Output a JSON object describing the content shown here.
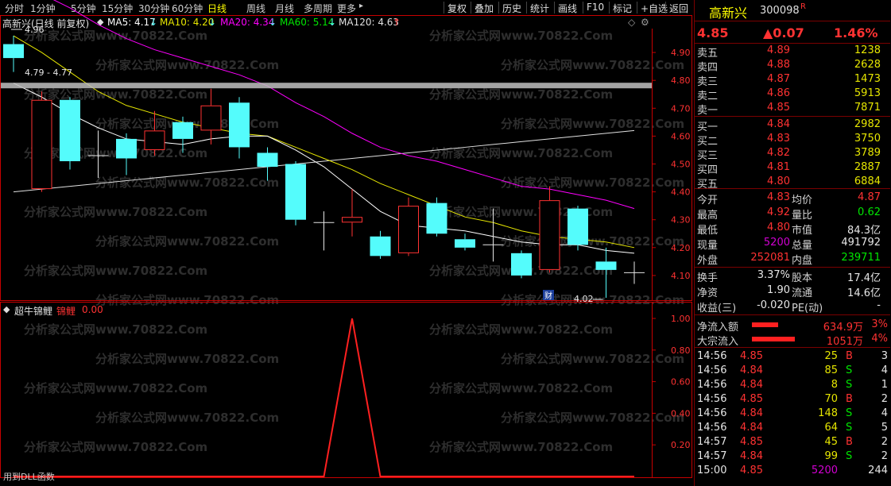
{
  "toolbar": {
    "periods": [
      "分时",
      "1分钟",
      "5分钟",
      "15分钟",
      "30分钟",
      "60分钟",
      "日线",
      "周线",
      "月线",
      "多周期",
      "更多"
    ],
    "active_period": "日线",
    "more_arrow": "▸",
    "buttons": [
      "复权",
      "叠加",
      "历史",
      "统计",
      "画线",
      "F10",
      "标记",
      "+自选",
      "返回"
    ]
  },
  "chart": {
    "stock_label": "高新兴(日线 前复权)",
    "ma5": "MA5: 4.17",
    "ma5_arrow": "↓",
    "ma10": "MA10: 4.20",
    "ma10_arrow": "↓",
    "ma20": "MA20: 4.34",
    "ma20_arrow": "↓",
    "ma60": "MA60: 5.14",
    "ma60_arrow": "↓",
    "ma120": "MA120: 4.63",
    "ma120_arrow": "↑",
    "high_annot": "4.96",
    "line_annot": "4.79 - 4.77",
    "low_annot": "4.02",
    "fin_badge": "财",
    "watermark": "分析家公式网www.70822.Com",
    "colors": {
      "up": "#ff3232",
      "down": "#54fcfc",
      "ma5": "#ffffff",
      "ma10": "#e6e600",
      "ma20": "#ff00ff",
      "ma60": "#00e600",
      "ma120": "#ffffff",
      "axis": "#c80000"
    }
  },
  "chart_data": [
    {
      "type": "candlestick",
      "y_ticks": [
        4.1,
        4.2,
        4.3,
        4.4,
        4.5,
        4.6,
        4.7,
        4.8,
        4.9
      ],
      "ylim": [
        4.02,
        4.98
      ],
      "candles": [
        {
          "o": 4.93,
          "h": 4.96,
          "l": 4.83,
          "c": 4.88
        },
        {
          "o": 4.41,
          "h": 4.76,
          "l": 4.4,
          "c": 4.73
        },
        {
          "o": 4.73,
          "h": 4.74,
          "l": 4.48,
          "c": 4.51
        },
        {
          "o": 4.53,
          "h": 4.62,
          "l": 4.45,
          "c": 4.53
        },
        {
          "o": 4.59,
          "h": 4.61,
          "l": 4.46,
          "c": 4.52
        },
        {
          "o": 4.55,
          "h": 4.69,
          "l": 4.53,
          "c": 4.62
        },
        {
          "o": 4.65,
          "h": 4.67,
          "l": 4.54,
          "c": 4.59
        },
        {
          "o": 4.62,
          "h": 4.77,
          "l": 4.57,
          "c": 4.71
        },
        {
          "o": 4.72,
          "h": 4.74,
          "l": 4.52,
          "c": 4.56
        },
        {
          "o": 4.54,
          "h": 4.56,
          "l": 4.44,
          "c": 4.49
        },
        {
          "o": 4.5,
          "h": 4.51,
          "l": 4.28,
          "c": 4.3
        },
        {
          "o": 4.29,
          "h": 4.33,
          "l": 4.19,
          "c": 4.29
        },
        {
          "o": 4.29,
          "h": 4.41,
          "l": 4.24,
          "c": 4.31
        },
        {
          "o": 4.24,
          "h": 4.26,
          "l": 4.16,
          "c": 4.17
        },
        {
          "o": 4.18,
          "h": 4.38,
          "l": 4.17,
          "c": 4.35
        },
        {
          "o": 4.36,
          "h": 4.38,
          "l": 4.24,
          "c": 4.25
        },
        {
          "o": 4.23,
          "h": 4.25,
          "l": 4.19,
          "c": 4.2
        },
        {
          "o": 4.21,
          "h": 4.34,
          "l": 4.15,
          "c": 4.21
        },
        {
          "o": 4.18,
          "h": 4.19,
          "l": 4.09,
          "c": 4.1
        },
        {
          "o": 4.12,
          "h": 4.42,
          "l": 4.11,
          "c": 4.37
        },
        {
          "o": 4.34,
          "h": 4.35,
          "l": 4.19,
          "c": 4.21
        },
        {
          "o": 4.15,
          "h": 4.2,
          "l": 4.02,
          "c": 4.12
        },
        {
          "o": 4.1,
          "h": 4.15,
          "l": 4.07,
          "c": 4.11
        }
      ],
      "ma5": [
        4.79,
        4.74,
        4.68,
        4.63,
        4.59,
        4.58,
        4.57,
        4.59,
        4.6,
        4.6,
        4.55,
        4.49,
        4.41,
        4.33,
        4.28,
        4.27,
        4.26,
        4.24,
        4.22,
        4.21,
        4.21,
        4.19,
        4.18
      ],
      "ma10": [
        4.96,
        4.9,
        4.83,
        4.76,
        4.71,
        4.68,
        4.65,
        4.63,
        4.61,
        4.6,
        4.56,
        4.52,
        4.48,
        4.43,
        4.39,
        4.35,
        4.31,
        4.29,
        4.26,
        4.24,
        4.23,
        4.22,
        4.2
      ],
      "ma20": [
        5.14,
        5.11,
        5.06,
        5.0,
        4.95,
        4.91,
        4.88,
        4.85,
        4.82,
        4.78,
        4.72,
        4.67,
        4.61,
        4.56,
        4.53,
        4.51,
        4.48,
        4.45,
        4.42,
        4.41,
        4.39,
        4.37,
        4.34
      ],
      "ma120": [
        4.4,
        4.41,
        4.42,
        4.43,
        4.44,
        4.45,
        4.46,
        4.47,
        4.48,
        4.49,
        4.5,
        4.51,
        4.52,
        4.53,
        4.54,
        4.55,
        4.56,
        4.57,
        4.58,
        4.59,
        4.6,
        4.61,
        4.62
      ],
      "ma_line": 4.78
    },
    {
      "type": "line",
      "title": "超牛锦鲤",
      "series_label": "锦鲤",
      "current_value": "0.00",
      "y_ticks": [
        0.0,
        0.2,
        0.4,
        0.6,
        0.8,
        1.0
      ],
      "ylim": [
        0,
        1.0
      ],
      "values": [
        0,
        0,
        0,
        0,
        0,
        0,
        0,
        0,
        0,
        0,
        0,
        0,
        1,
        0,
        0,
        0,
        0,
        0,
        0,
        0,
        0,
        0,
        0
      ]
    }
  ],
  "indicator_footer": "用到DLL函数",
  "panel": {
    "name": "高新兴",
    "code": "300098",
    "tag": "R",
    "price": "4.85",
    "change": "▲0.07",
    "change_pct": "1.46%",
    "asks": [
      {
        "label": "卖五",
        "price": "4.89",
        "vol": "1238"
      },
      {
        "label": "卖四",
        "price": "4.88",
        "vol": "2628"
      },
      {
        "label": "卖三",
        "price": "4.87",
        "vol": "1473"
      },
      {
        "label": "卖二",
        "price": "4.86",
        "vol": "5913"
      },
      {
        "label": "卖一",
        "price": "4.85",
        "vol": "7871"
      }
    ],
    "bids": [
      {
        "label": "买一",
        "price": "4.84",
        "vol": "2982"
      },
      {
        "label": "买二",
        "price": "4.83",
        "vol": "3750"
      },
      {
        "label": "买三",
        "price": "4.82",
        "vol": "3789"
      },
      {
        "label": "买四",
        "price": "4.81",
        "vol": "2887"
      },
      {
        "label": "买五",
        "price": "4.80",
        "vol": "6884"
      }
    ],
    "stats": [
      {
        "l1": "今开",
        "v1": "4.83",
        "c1": "red",
        "l2": "均价",
        "v2": "4.87",
        "c2": "red"
      },
      {
        "l1": "最高",
        "v1": "4.92",
        "c1": "red",
        "l2": "量比",
        "v2": "0.62",
        "c2": "green"
      },
      {
        "l1": "最低",
        "v1": "4.80",
        "c1": "red",
        "l2": "市值",
        "v2": "84.3亿",
        "c2": "white"
      },
      {
        "l1": "现量",
        "v1": "5200",
        "c1": "purple",
        "l2": "总量",
        "v2": "491792",
        "c2": "white"
      },
      {
        "l1": "外盘",
        "v1": "252081",
        "c1": "red",
        "l2": "内盘",
        "v2": "239711",
        "c2": "green"
      }
    ],
    "stats2": [
      {
        "l1": "换手",
        "v1": "3.37%",
        "l2": "股本",
        "v2": "17.4亿"
      },
      {
        "l1": "净资",
        "v1": "1.90",
        "l2": "流通",
        "v2": "14.6亿"
      },
      {
        "l1": "收益(三)",
        "v1": "-0.020",
        "l2": "PE(动)",
        "v2": "-"
      }
    ],
    "flows": [
      {
        "label": "净流入额",
        "amount": "634.9万",
        "pct": "3%",
        "bar": 0.55
      },
      {
        "label": "大宗流入",
        "amount": "1051万",
        "pct": "4%",
        "bar": 0.9
      }
    ],
    "trades": [
      {
        "t": "14:56",
        "p": "4.85",
        "pc": "red",
        "v": "25",
        "vc": "yellow",
        "s": "B",
        "sc": "red",
        "n": "3"
      },
      {
        "t": "14:56",
        "p": "4.84",
        "pc": "red",
        "v": "85",
        "vc": "yellow",
        "s": "S",
        "sc": "green",
        "n": "4"
      },
      {
        "t": "14:56",
        "p": "4.84",
        "pc": "red",
        "v": "8",
        "vc": "yellow",
        "s": "S",
        "sc": "green",
        "n": "1"
      },
      {
        "t": "14:56",
        "p": "4.85",
        "pc": "red",
        "v": "70",
        "vc": "yellow",
        "s": "B",
        "sc": "red",
        "n": "2"
      },
      {
        "t": "14:56",
        "p": "4.84",
        "pc": "red",
        "v": "148",
        "vc": "yellow",
        "s": "S",
        "sc": "green",
        "n": "4"
      },
      {
        "t": "14:56",
        "p": "4.84",
        "pc": "red",
        "v": "64",
        "vc": "yellow",
        "s": "S",
        "sc": "green",
        "n": "5"
      },
      {
        "t": "14:57",
        "p": "4.85",
        "pc": "red",
        "v": "45",
        "vc": "yellow",
        "s": "B",
        "sc": "red",
        "n": "2"
      },
      {
        "t": "14:57",
        "p": "4.84",
        "pc": "red",
        "v": "99",
        "vc": "yellow",
        "s": "S",
        "sc": "green",
        "n": "2"
      },
      {
        "t": "15:00",
        "p": "4.85",
        "pc": "red",
        "v": "5200",
        "vc": "purple",
        "s": "",
        "sc": "white",
        "n": "244"
      }
    ]
  }
}
